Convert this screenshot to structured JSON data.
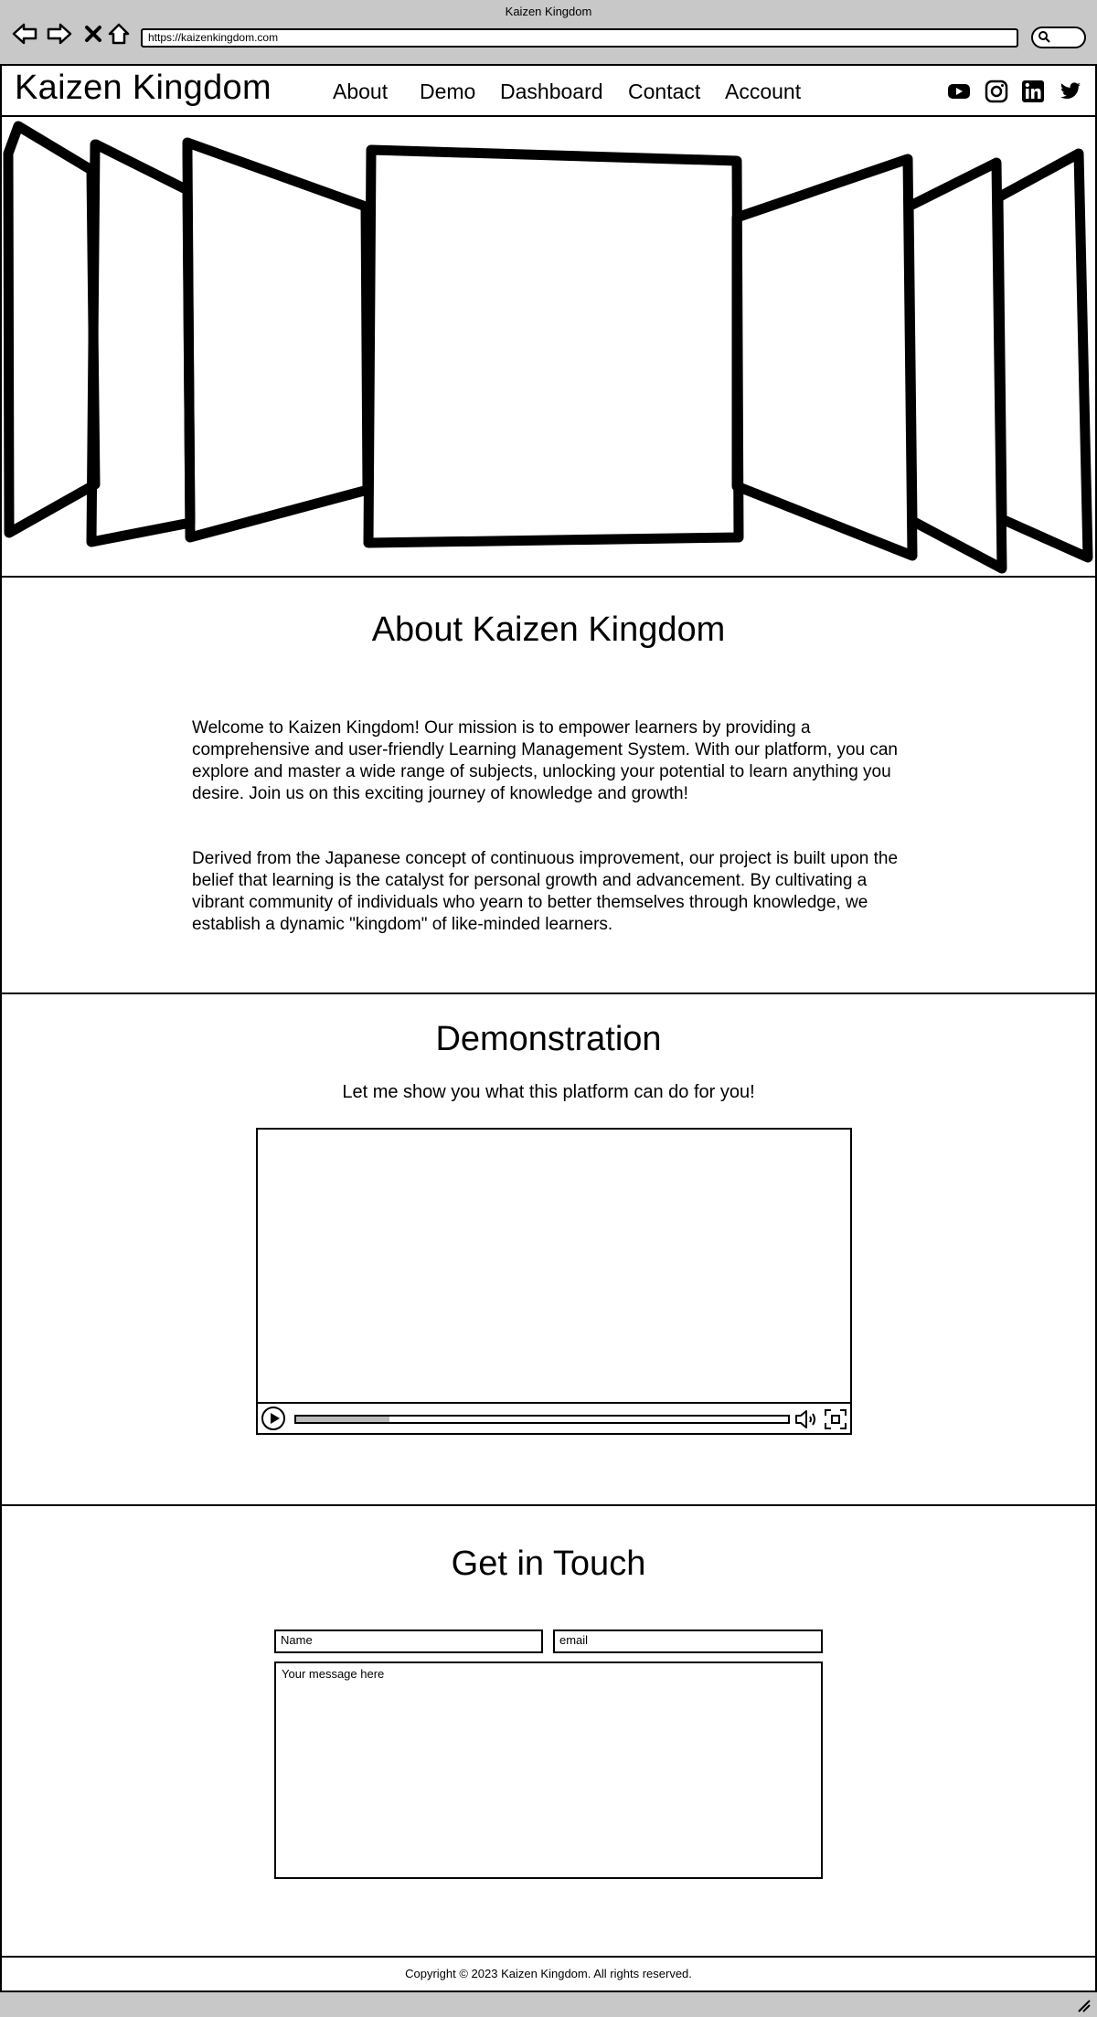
{
  "window": {
    "title": "Kaizen Kingdom",
    "url": "https://kaizenkingdom.com"
  },
  "header": {
    "logo": "Kaizen Kingdom",
    "nav": [
      {
        "label": "About"
      },
      {
        "label": "Demo"
      },
      {
        "label": "Dashboard"
      },
      {
        "label": "Contact"
      },
      {
        "label": "Account"
      }
    ],
    "social": [
      "youtube-icon",
      "instagram-icon",
      "linkedin-icon",
      "twitter-icon"
    ]
  },
  "about": {
    "title": "About Kaizen Kingdom",
    "paragraphs": [
      "Welcome to Kaizen Kingdom! Our mission is to empower learners by providing a comprehensive and user-friendly Learning Management System. With our platform, you can explore and master a wide range of subjects, unlocking your potential to learn anything you desire. Join us on this exciting journey of knowledge and growth!",
      "Derived from the Japanese concept of continuous improvement, our project is built upon the belief that learning is the catalyst for personal growth and advancement. By cultivating a vibrant community of individuals who yearn to better themselves through knowledge, we establish a dynamic \"kingdom\" of like-minded learners."
    ]
  },
  "demo": {
    "title": "Demonstration",
    "subtitle": "Let me show you what this platform can do for you!",
    "video_progress": 0.19
  },
  "contact": {
    "title": "Get in Touch",
    "name_placeholder": "Name",
    "email_placeholder": "email",
    "message_placeholder": "Your message here"
  },
  "footer": {
    "text": "Copyright © 2023 Kaizen Kingdom. All rights reserved."
  }
}
